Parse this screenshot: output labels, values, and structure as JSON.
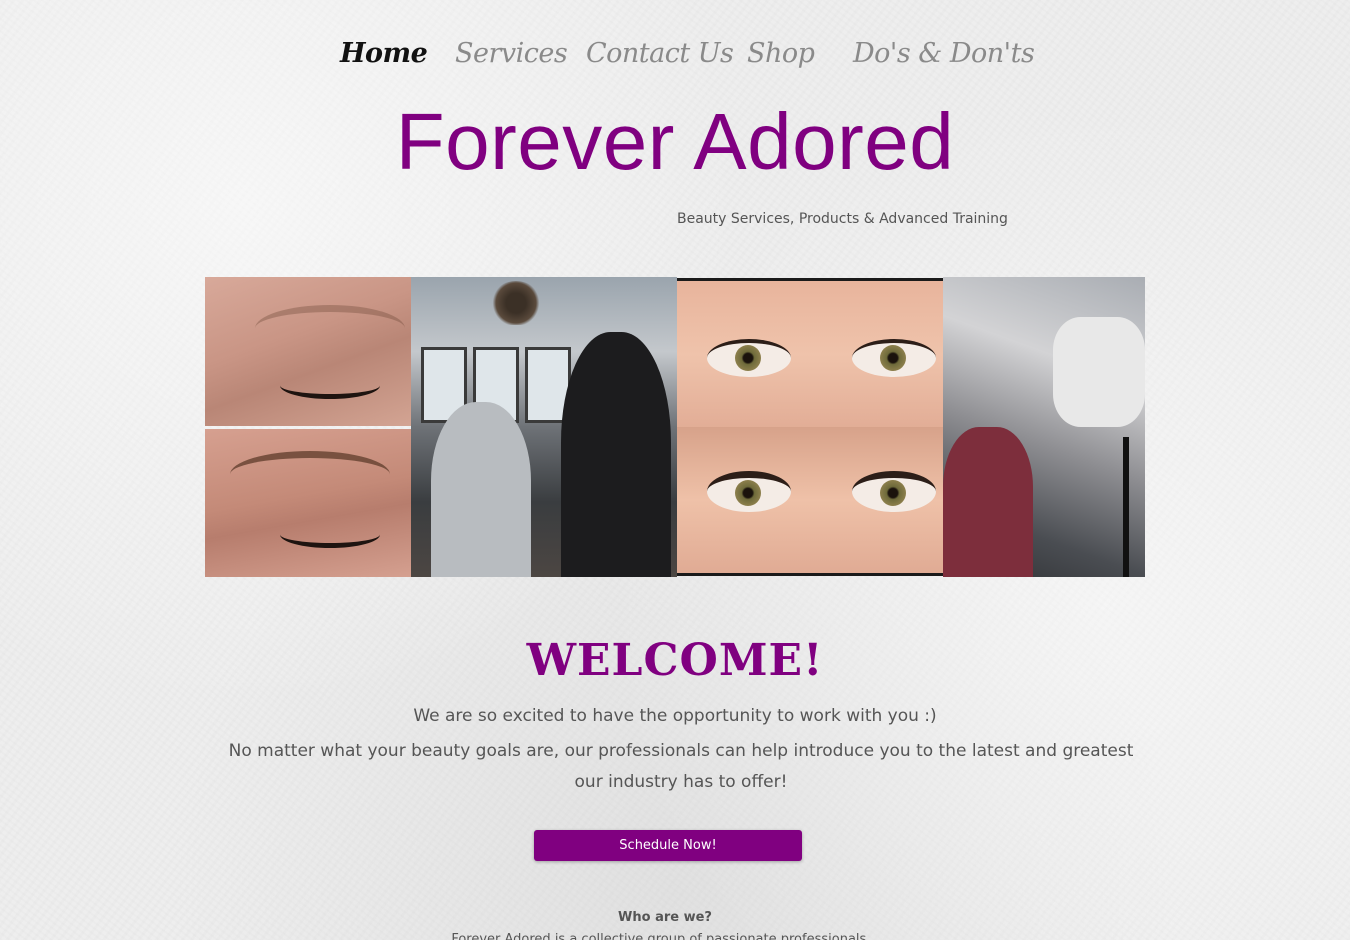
{
  "nav": {
    "items": [
      {
        "label": "Home",
        "active": true
      },
      {
        "label": "Services",
        "active": false
      },
      {
        "label": "Contact Us",
        "active": false
      },
      {
        "label": "Shop",
        "active": false
      },
      {
        "label": "Do's & Don'ts",
        "active": false
      }
    ]
  },
  "brand": {
    "title": "Forever Adored",
    "tagline": "Beauty Services, Products & Advanced Training",
    "color": "#800080"
  },
  "gallery": {
    "images": [
      {
        "name": "brow-before-photo"
      },
      {
        "name": "brow-after-photo"
      },
      {
        "name": "studio-training-photo"
      },
      {
        "name": "lash-before-photo"
      },
      {
        "name": "lash-after-photo"
      },
      {
        "name": "lash-application-photo"
      }
    ]
  },
  "welcome": {
    "title": "WELCOME!",
    "line1": "We are so excited to have the opportunity to work with you :)",
    "line2": "No matter what your beauty goals are, our professionals can help introduce you to the latest and greatest our industry has to offer!",
    "cta_label": "Schedule Now!"
  },
  "about": {
    "heading": "Who are we?",
    "text": "Forever Adored is a collective group of passionate professionals..."
  }
}
